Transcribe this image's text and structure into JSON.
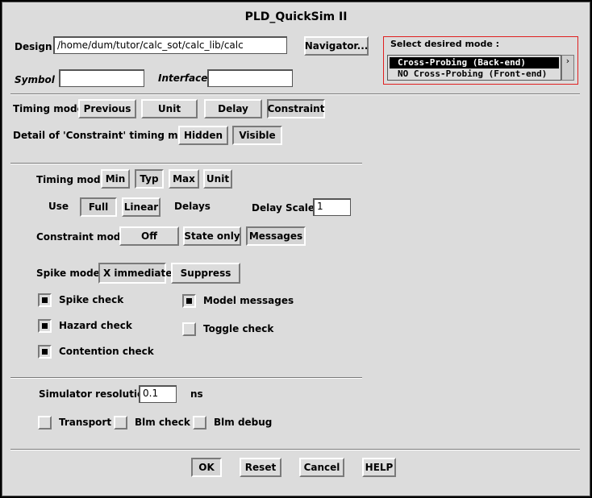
{
  "window": {
    "title": "PLD_QuickSim II"
  },
  "design": {
    "label": "Design",
    "value": "/home/dum/tutor/calc_sot/calc_lib/calc",
    "navigator_label": "Navigator...",
    "symbol_label": "Symbol",
    "symbol_value": "",
    "interface_label": "Interface",
    "interface_value": ""
  },
  "mode_select": {
    "label": "Select desired mode :",
    "options": [
      "Cross-Probing (Back-end)",
      "NO Cross-Probing (Front-end)"
    ],
    "selected": "Cross-Probing (Back-end)"
  },
  "timing_top": {
    "label": "Timing mode",
    "options": [
      "Previous",
      "Unit",
      "Delay",
      "Constraint"
    ],
    "selected": "Constraint"
  },
  "detail": {
    "label": "Detail of 'Constraint' timing mode",
    "options": [
      "Hidden",
      "Visible"
    ],
    "selected": "Visible"
  },
  "timing_inner": {
    "label": "Timing mode",
    "options": [
      "Min",
      "Typ",
      "Max",
      "Unit"
    ],
    "selected": "Typ"
  },
  "use": {
    "label": "Use",
    "options": [
      "Full",
      "Linear"
    ],
    "selected": "Full",
    "suffix": "Delays",
    "delay_scale_label": "Delay Scale",
    "delay_scale_value": "1"
  },
  "constraint": {
    "label": "Constraint mode",
    "options": [
      "Off",
      "State only",
      "Messages"
    ],
    "selected": "Messages"
  },
  "spike": {
    "label": "Spike model",
    "options": [
      "X immediate",
      "Suppress"
    ],
    "selected": "X immediate"
  },
  "checks": [
    {
      "label": "Spike check",
      "checked": true
    },
    {
      "label": "Model messages",
      "checked": true
    },
    {
      "label": "Hazard check",
      "checked": true
    },
    {
      "label": "Toggle check",
      "checked": false
    },
    {
      "label": "Contention check",
      "checked": true
    }
  ],
  "resolution": {
    "label": "Simulator resolution",
    "value": "0.1",
    "unit": "ns"
  },
  "bottom_checks": [
    {
      "label": "Transport",
      "checked": false
    },
    {
      "label": "Blm check",
      "checked": false
    },
    {
      "label": "Blm debug",
      "checked": false
    }
  ],
  "footer": {
    "ok": "OK",
    "reset": "Reset",
    "cancel": "Cancel",
    "help": "HELP"
  }
}
